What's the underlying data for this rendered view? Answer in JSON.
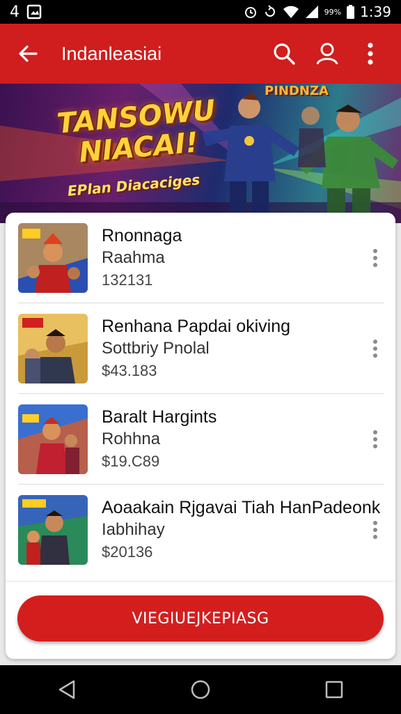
{
  "status_bar": {
    "left_number": "4",
    "battery_text": "99%",
    "time": "1:39",
    "icons": [
      "gallery-icon",
      "alarm-icon",
      "sync-icon",
      "wifi-icon",
      "signal-icon"
    ]
  },
  "app_bar": {
    "title": "Indanleasiai",
    "icons": [
      "back-arrow-icon",
      "search-icon",
      "account-icon",
      "more-vert-icon"
    ],
    "color": "#d01d1d"
  },
  "banner": {
    "title_line1": "TANSOWU",
    "title_line2": "NIACAI!",
    "subtitle": "EPlan Diacaciges",
    "corner_text": "PINDNZA"
  },
  "items": [
    {
      "name": "Rnonnaga",
      "subtitle": "Raahma",
      "price": "132131"
    },
    {
      "name": "Renhana Papdai okiving",
      "subtitle": "Sottbriy Pnolal",
      "price": "$43.183"
    },
    {
      "name": "Baralt Hargints",
      "subtitle": "Rohhna",
      "price": "$19.C89"
    },
    {
      "name": "Aoaakain Rjgavai Tiah HanPadeonk",
      "subtitle": "Iabhihay",
      "price": "$20136"
    }
  ],
  "cta": {
    "label": "VIEGIUEJKEPIASG",
    "color": "#d41e1e"
  },
  "nav_bar": {
    "icons": [
      "back-triangle-icon",
      "home-circle-icon",
      "recents-square-icon"
    ]
  }
}
